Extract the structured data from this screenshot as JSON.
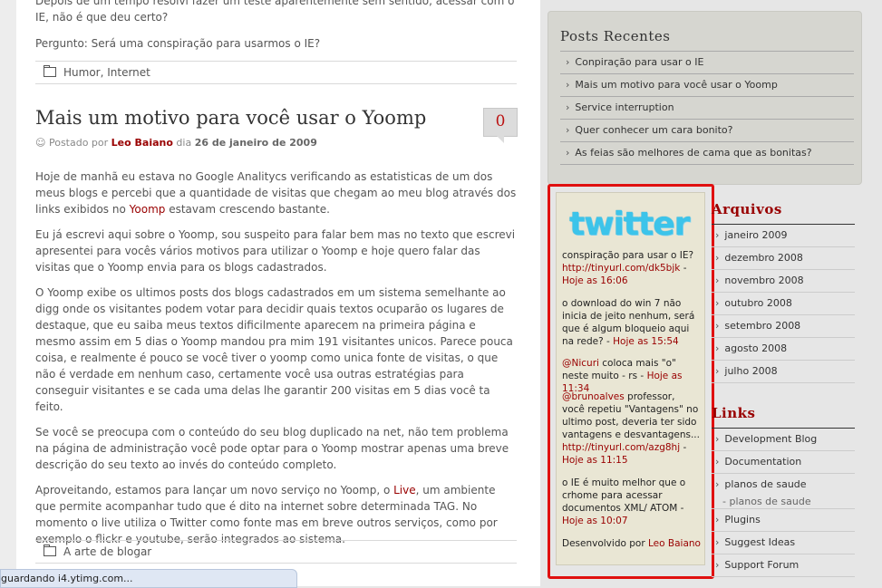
{
  "content": {
    "top_text": "Depois de um tempo resolvi fazer um teste aparentemente sem sentido, acessar com o IE, não é que deu certo?",
    "question": "Pergunto: Será uma conspiração para usarmos o IE?",
    "prev_categories": "Humor, Internet",
    "post": {
      "title": "Mais um motivo para você usar o Yoomp",
      "comments": "0",
      "meta_prefix": "Postado por",
      "author": "Leo Baiano",
      "meta_mid": "dia",
      "date": "26 de janeiro de 2009",
      "p1_a": "Hoje de manhã eu estava no Google Analitycs verificando as estatisticas de um dos meus blogs e percebi que a quantidade de visitas que chegam ao meu blog através dos links exibidos no",
      "p1_link": "Yoomp",
      "p1_b": "estavam crescendo bastante.",
      "p2": "Eu já escrevi aqui sobre o Yoomp, sou suspeito para falar bem mas no texto que escrevi apresentei para vocês vários motivos para utilizar o Yoomp e hoje quero falar das visitas que o Yoomp envia para os blogs cadastrados.",
      "p3": "O Yoomp exibe os ultimos posts dos blogs cadastrados em um sistema semelhante ao digg onde os visitantes podem votar para decidir quais textos ocuparão os lugares de destaque, que eu saiba meus textos dificilmente aparecem na primeira página e mesmo assim em 5 dias o Yoomp mandou pra mim 191 visitantes unicos. Parece pouca coisa, e realmente é pouco se você tiver o yoomp como unica fonte de visitas, o que não é verdade em nenhum caso, certamente você usa outras estratégias para conseguir visitantes e se cada uma delas lhe garantir 200 visitas em 5 dias você ta feito.",
      "p4": "Se você se preocupa com o conteúdo do seu blog duplicado na net, não tem problema na página de administração você pode optar para o Yoomp mostrar apenas uma breve descrição do seu texto ao invés do conteúdo completo.",
      "p5_a": "Aproveitando, estamos para lançar um novo serviço no Yoomp, o",
      "p5_link": "Live",
      "p5_b": ", um ambiente que permite acompanhar tudo que é dito na internet sobre determinada TAG. No momento o live utiliza o Twitter como fonte mas em breve outros serviços, como por exemplo o flickr e youtube, serão integrados ao sistema.",
      "category": "A arte de blogar"
    }
  },
  "sidebar": {
    "recent_title": "Posts Recentes",
    "recent": [
      "Conpiração para usar o IE",
      "Mais um motivo para você usar o Yoomp",
      "Service interruption",
      "Quer conhecer um cara bonito?",
      "As feias são melhores de cama que as bonitas?"
    ],
    "twitter": {
      "logo": "twitter",
      "tweets": [
        {
          "text": "conspiração para usar o IE?",
          "link": "http://tinyurl.com/dk5bjk",
          "sep": " - ",
          "time": "Hoje as 16:06"
        },
        {
          "text": "o download do win 7 não inicia de jeito nenhum, será que é algum bloqueio aqui na rede? -",
          "link": "",
          "sep": "",
          "time": "Hoje as 15:54"
        },
        {
          "mention": "@Nicuri",
          "text": " coloca mais \"o\" neste muito - rs - ",
          "time": "Hoje as 11:34"
        },
        {
          "mention": "@brunoalves",
          "text": " professor, você repetiu \"Vantagens\" no ultimo post, deveria ter sido vantagens e desvantagens...",
          "link": "http://tinyurl.com/azg8hj",
          "sep": " - ",
          "time": "Hoje as 11:15"
        },
        {
          "text": "o IE é muito melhor que o crhome para acessar documentos XML/ ATOM - ",
          "time": "Hoje as 10:07"
        }
      ],
      "footer_prefix": "Desenvolvido por",
      "footer_link": "Leo Baiano"
    },
    "archives_title": "Arquivos",
    "archives": [
      "janeiro 2009",
      "dezembro 2008",
      "novembro 2008",
      "outubro 2008",
      "setembro 2008",
      "agosto 2008",
      "julho 2008"
    ],
    "links_title": "Links",
    "links": [
      "Development Blog",
      "Documentation",
      "planos de saude"
    ],
    "links_sub": "- planos de saude",
    "links2": [
      "Plugins",
      "Suggest Ideas",
      "Support Forum"
    ]
  },
  "status": "guardando i4.ytimg.com..."
}
